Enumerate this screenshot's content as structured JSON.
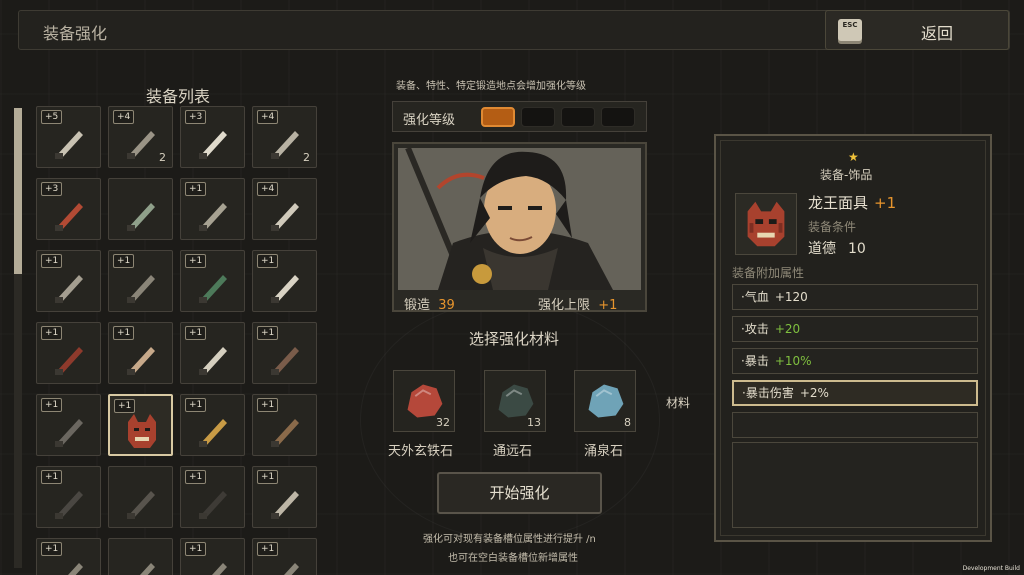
{
  "header": {
    "title": "装备强化",
    "esc_key": "ESC",
    "back_label": "返回"
  },
  "equipment_list": {
    "title": "装备列表",
    "items": [
      {
        "level": "+5",
        "qty": "",
        "icon": "scroll-icon"
      },
      {
        "level": "+4",
        "qty": "2",
        "icon": "dagger-icon"
      },
      {
        "level": "+3",
        "qty": "",
        "icon": "bead-necklace-icon"
      },
      {
        "level": "+4",
        "qty": "2",
        "icon": "sword-icon"
      },
      {
        "level": "+3",
        "qty": "",
        "icon": "red-pouch-icon"
      },
      {
        "level": "",
        "qty": "",
        "icon": "jade-pendant-icon"
      },
      {
        "level": "+1",
        "qty": "",
        "icon": "short-sword-icon"
      },
      {
        "level": "+4",
        "qty": "",
        "icon": "broad-blade-icon"
      },
      {
        "level": "+1",
        "qty": "",
        "icon": "knife-icon"
      },
      {
        "level": "+1",
        "qty": "",
        "icon": "spear-icon"
      },
      {
        "level": "+1",
        "qty": "",
        "icon": "jade-bracelet-icon"
      },
      {
        "level": "+1",
        "qty": "",
        "icon": "pearl-necklace-icon"
      },
      {
        "level": "+1",
        "qty": "",
        "icon": "red-staff-icon"
      },
      {
        "level": "+1",
        "qty": "",
        "icon": "curved-knife-icon"
      },
      {
        "level": "+1",
        "qty": "",
        "icon": "cleaver-icon"
      },
      {
        "level": "+1",
        "qty": "",
        "icon": "long-staff-icon"
      },
      {
        "level": "+1",
        "qty": "",
        "icon": "gong-stand-icon"
      },
      {
        "level": "+1",
        "qty": "",
        "icon": "dragon-mask-icon"
      },
      {
        "level": "+1",
        "qty": "",
        "icon": "golden-scroll-icon"
      },
      {
        "level": "+1",
        "qty": "",
        "icon": "bamboo-tube-icon"
      },
      {
        "level": "+1",
        "qty": "",
        "icon": "meteor-hammer-icon"
      },
      {
        "level": "",
        "qty": "",
        "icon": "armor-icon"
      },
      {
        "level": "+1",
        "qty": "",
        "icon": "robe-icon"
      },
      {
        "level": "+1",
        "qty": "",
        "icon": "dagger-2-icon"
      },
      {
        "level": "+1",
        "qty": "",
        "icon": "item-icon"
      },
      {
        "level": "",
        "qty": "",
        "icon": "item-icon"
      },
      {
        "level": "+1",
        "qty": "",
        "icon": "item-icon"
      },
      {
        "level": "+1",
        "qty": "",
        "icon": "item-icon"
      }
    ],
    "selected_index": 17
  },
  "enhance": {
    "hint_top": "装备、特性、特定锻造地点会增加强化等级",
    "level_label": "强化等级",
    "level_filled": 1,
    "level_total": 4,
    "forge_label": "锻造",
    "forge_value": "39",
    "cap_label": "强化上限",
    "cap_value": "+1",
    "choose_material": "选择强化材料",
    "materials": [
      {
        "name": "天外玄铁石",
        "qty": "32",
        "color": "#b5483a"
      },
      {
        "name": "通远石",
        "qty": "13",
        "color": "#3b4a44"
      },
      {
        "name": "涌泉石",
        "qty": "8",
        "color": "#6fa3b7"
      }
    ],
    "material_side_label": "材料",
    "start_button": "开始强化",
    "hint_bottom_1": "强化可对现有装备槽位属性进行提升 /n",
    "hint_bottom_2": "也可在空白装备槽位新增属性"
  },
  "detail": {
    "category": "装备-饰品",
    "name": "龙王面具",
    "plus": "+1",
    "condition_label": "装备条件",
    "requirement_name": "道德",
    "requirement_value": "10",
    "attr_title": "装备附加属性",
    "attrs": [
      {
        "name": "·气血",
        "value": "+120",
        "color": "#e2dccb"
      },
      {
        "name": "·攻击",
        "value": "+20",
        "color": "#7fbf3f"
      },
      {
        "name": "·暴击",
        "value": "+10%",
        "color": "#7fbf3f"
      },
      {
        "name": "·暴击伤害",
        "value": "+2%",
        "color": "#e2dccb"
      }
    ]
  },
  "footer": {
    "dev_build": "Development Build"
  },
  "colors": {
    "accent_orange": "#e8952d",
    "positive_green": "#7fbf3f",
    "highlight_border": "#cdbb8e"
  }
}
